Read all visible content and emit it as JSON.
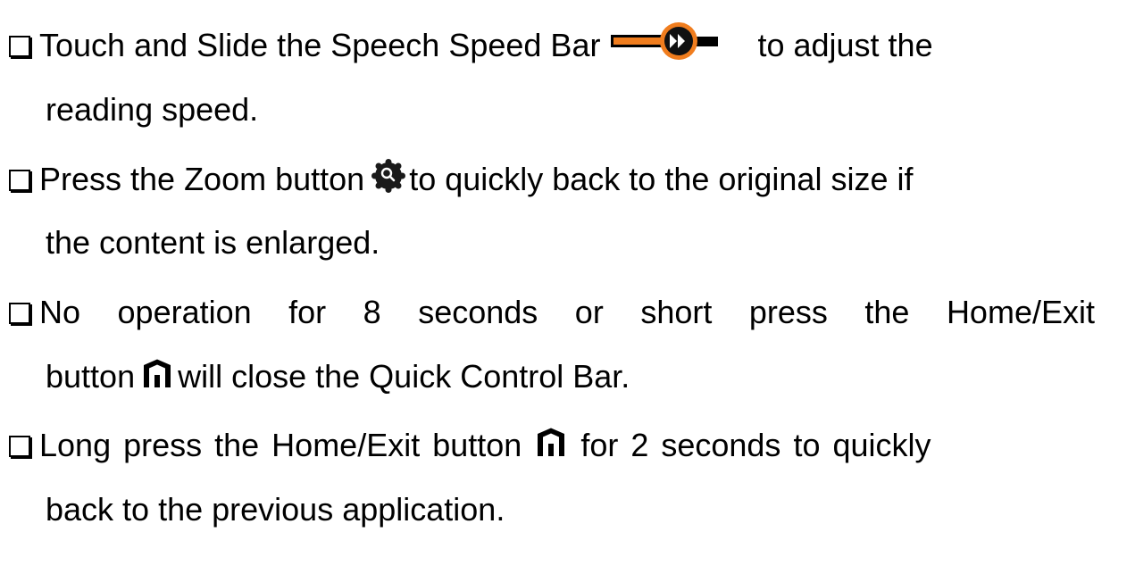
{
  "items": [
    {
      "line1_before": "Touch and Slide the Speech Speed Bar",
      "line1_after": "to adjust the",
      "line2": "reading speed.",
      "icon": "speech-speed-bar-icon"
    },
    {
      "line1_before": "Press the Zoom button",
      "line1_after": "to quickly back to the original size if",
      "line2": "the content is enlarged.",
      "icon": "zoom-icon"
    },
    {
      "line1_words": [
        "No",
        "operation",
        "for",
        "8",
        "seconds",
        "or",
        "short",
        "press",
        "the",
        "Home/Exit"
      ],
      "line2_before": "button",
      "line2_after": "will close the Quick Control Bar.",
      "icon": "home-icon"
    },
    {
      "line1_before": "Long press the Home/Exit button",
      "line1_after": "for 2 seconds to quickly",
      "line2": "back to the previous application.",
      "icon": "home-icon"
    }
  ],
  "colors": {
    "text": "#000000",
    "speed_bar_orange": "#f07d1e",
    "speed_bar_black": "#000000",
    "zoom_icon": "#1a1a1a"
  }
}
